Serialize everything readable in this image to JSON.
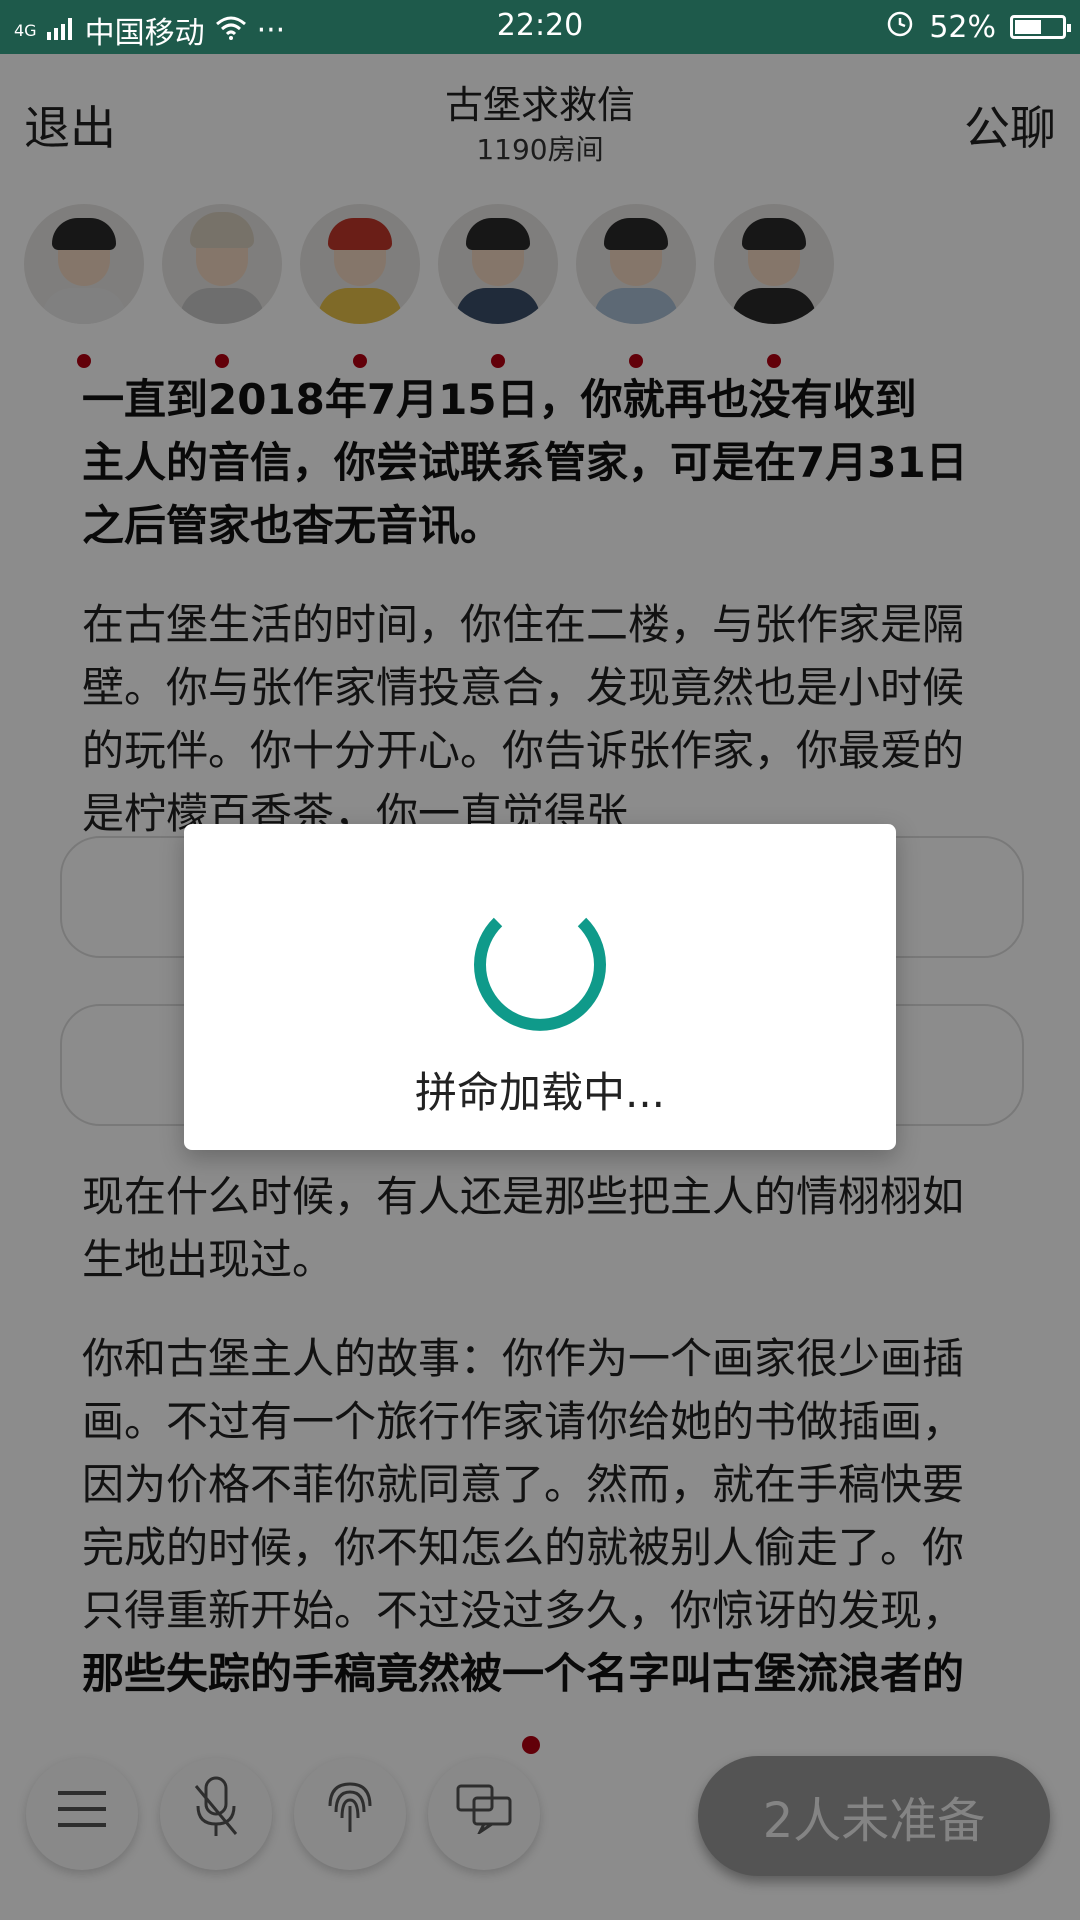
{
  "status": {
    "network": "4G",
    "carrier": "中国移动",
    "more": "···",
    "time": "22:20",
    "battery": "52%"
  },
  "header": {
    "exit": "退出",
    "title": "古堡求救信",
    "room": "1190房间",
    "public_chat": "公聊"
  },
  "avatars": [
    {
      "name": "avatar-1"
    },
    {
      "name": "avatar-2"
    },
    {
      "name": "avatar-3"
    },
    {
      "name": "avatar-4"
    },
    {
      "name": "avatar-5"
    },
    {
      "name": "avatar-6"
    }
  ],
  "content": {
    "p1_top": "一直到2018年7月15日，你就再也没有收到",
    "p1_bold": "主人的音信，你尝试联系管家，可是在7月31日之后管家也杳无音讯。",
    "p2": "在古堡生活的时间，你住在二楼，与张作家是隔壁。你与张作家情投意合，发现竟然也是小时候的玩伴。你十分开心。你告诉张作家，你最爱的是柠檬百香茶，你一直觉得张",
    "p3": "现在什么时候，有人还是那些把主人的情栩栩如生地出现过。",
    "p4_a": "你和古堡主人的故事：你作为一个画家很少画插画。不过有一个旅行作家请你给她的书做插画，因为价格不菲你就同意了。然而，就在手稿快要完成的时候，你不知怎么的就被别人偷走了。你只得重新开始。不过没过多久，你惊讶的发现，",
    "p4_bold": "那些失踪的手稿竟然被一个名字叫古堡流浪者的人出版成册。",
    "p4_c": "那"
  },
  "bottom": {
    "menu_icon": "menu-icon",
    "mic_icon": "microphone-icon",
    "fingerprint_icon": "fingerprint-icon",
    "chat_icon": "chat-icon",
    "not_ready": "2人未准备"
  },
  "dialog": {
    "loading_text": "拼命加载中..."
  },
  "colors": {
    "status_bar": "#1e5a4b",
    "spinner": "#0f9a8a",
    "dot": "#b30012"
  }
}
